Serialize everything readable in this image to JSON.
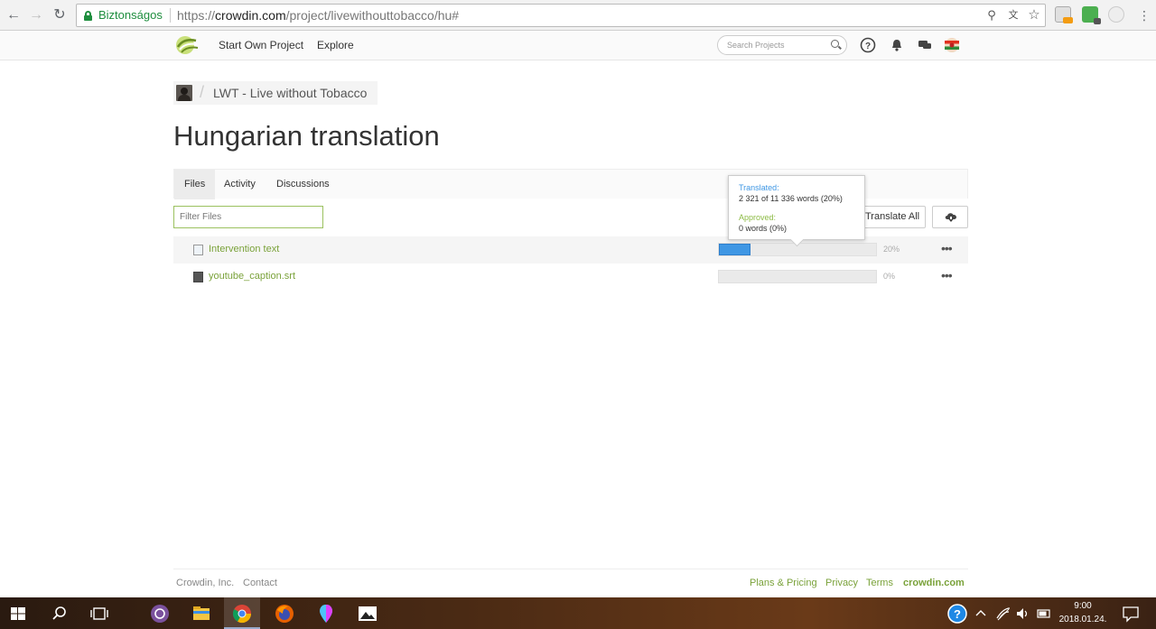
{
  "browser": {
    "secure_label": "Biztonságos",
    "url_prefix": "https://",
    "url_host": "crowdin.com",
    "url_path": "/project/livewithouttobacco/hu#"
  },
  "header": {
    "nav": [
      "Start Own Project",
      "Explore"
    ],
    "search_placeholder": "Search Projects"
  },
  "breadcrumb": {
    "project_name": "LWT - Live without Tobacco"
  },
  "page_title": "Hungarian translation",
  "tabs": [
    "Files",
    "Activity",
    "Discussions"
  ],
  "active_tab": "Files",
  "filter_placeholder": "Filter Files",
  "buttons": {
    "translate_all": "Translate All"
  },
  "files": [
    {
      "name": "Intervention text",
      "progress": 20,
      "progress_label": "20%"
    },
    {
      "name": "youtube_caption.srt",
      "progress": 0,
      "progress_label": "0%"
    }
  ],
  "tooltip": {
    "translated_label": "Translated:",
    "translated_value": "2 321 of 11 336 words (20%)",
    "approved_label": "Approved:",
    "approved_value": "0 words (0%)"
  },
  "footer": {
    "left": [
      "Crowdin, Inc.",
      "Contact"
    ],
    "right": [
      "Plans & Pricing",
      "Privacy",
      "Terms"
    ],
    "brand": "crowdin.com"
  },
  "taskbar": {
    "time": "9:00",
    "date": "2018.01.24."
  },
  "colors": {
    "accent_green": "#7aa23a",
    "progress_blue": "#3f97e4"
  }
}
